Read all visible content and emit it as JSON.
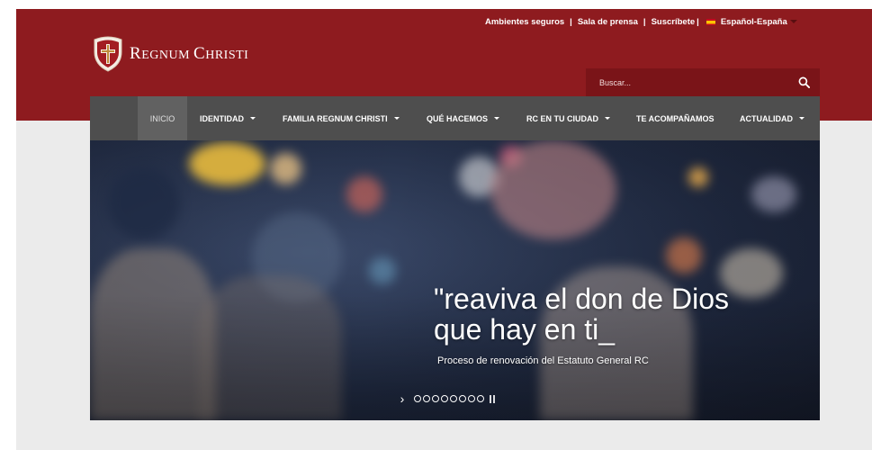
{
  "brand": {
    "logo_text_first_cap": "R",
    "logo_text_first_rest": "EGNUM",
    "logo_text_second_cap": "C",
    "logo_text_second_rest": "HRISTI",
    "primary_color": "#8e1b1f",
    "nav_color": "#4e4e4e"
  },
  "toplinks": {
    "ambientes": "Ambientes seguros",
    "sala": "Sala de prensa",
    "suscribete": "Suscríbete",
    "language": "Español-España",
    "separator": "|"
  },
  "search": {
    "placeholder": "Buscar...",
    "icon": "search-icon"
  },
  "nav": {
    "items": [
      {
        "label": "INICIO",
        "has_dropdown": false,
        "active": true
      },
      {
        "label": "IDENTIDAD",
        "has_dropdown": true
      },
      {
        "label": "FAMILIA REGNUM CHRISTI",
        "has_dropdown": true
      },
      {
        "label": "QUÉ HACEMOS",
        "has_dropdown": true
      },
      {
        "label": "RC EN TU CIUDAD",
        "has_dropdown": true
      },
      {
        "label": "TE ACOMPAÑAMOS",
        "has_dropdown": false
      },
      {
        "label": "ACTUALIDAD",
        "has_dropdown": true
      }
    ]
  },
  "hero": {
    "title_line1": "\"reaviva el don de Dios",
    "title_line2": "que hay en ti_",
    "subtitle": "Proceso de renovación del Estatuto General RC",
    "slide_count": 8,
    "next_glyph": "›"
  }
}
